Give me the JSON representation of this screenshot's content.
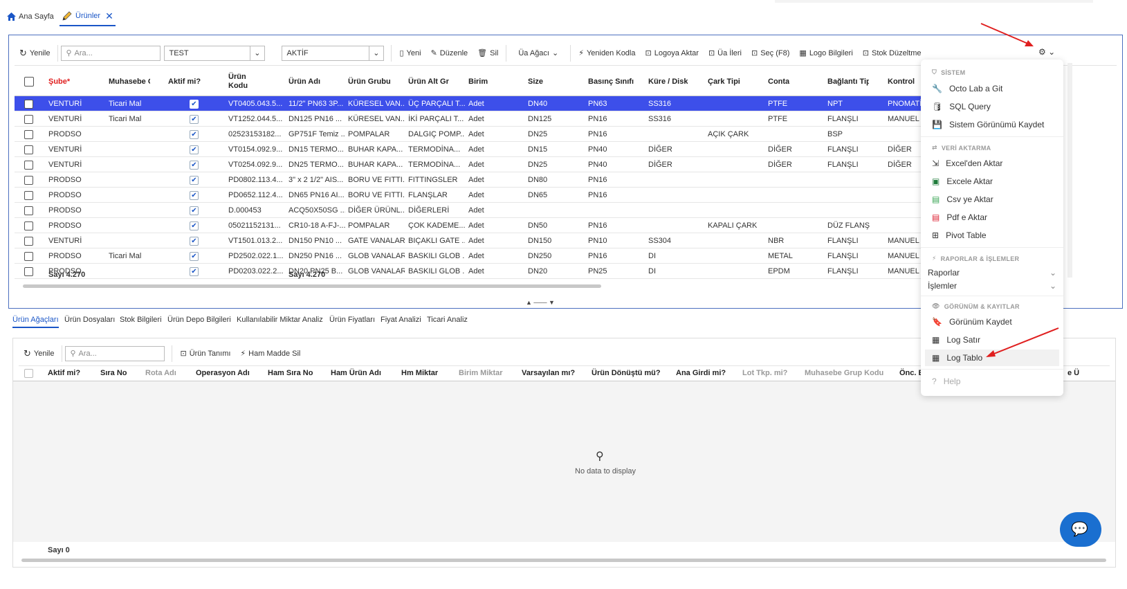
{
  "tabs": [
    {
      "label": "Ana Sayfa"
    },
    {
      "label": "Ürünler"
    }
  ],
  "toolbar": {
    "refresh": "Yenile",
    "search_placeholder": "Ara...",
    "filter1": "TEST",
    "filter2": "AKTİF",
    "new": "Yeni",
    "edit": "Düzenle",
    "delete": "Sil",
    "tree": "Üa Ağacı",
    "recode": "Yeniden Kodla",
    "logo_transfer": "Logoya Aktar",
    "ua_next": "Üa İleri",
    "select": "Seç (F8)",
    "logo_info": "Logo Bilgileri",
    "stock_fix": "Stok Düzeltme"
  },
  "table": {
    "columns": [
      "Şube",
      "Muhasebe G",
      "Aktif mi?",
      "Ürün Kodu",
      "Ürün Adı",
      "Ürün Grubu",
      "Ürün Alt Gr",
      "Birim",
      "Size",
      "Basınç Sınıfı",
      "Küre / Disk",
      "Çark Tipi",
      "Conta",
      "Bağlantı Tip",
      "Kontrol"
    ],
    "required_mark": "*",
    "rows": [
      [
        "VENTURİ",
        "Ticari Mal",
        "",
        "VT0405.043.5...",
        "11/2\" PN63 3P...",
        "KÜRESEL VAN...",
        "ÜÇ PARÇALI T...",
        "Adet",
        "DN40",
        "PN63",
        "SS316",
        "",
        "PTFE",
        "NPT",
        "PNOMATİ"
      ],
      [
        "VENTURİ",
        "Ticari Mal",
        "",
        "VT1252.044.5...",
        "DN125 PN16 ...",
        "KÜRESEL VAN...",
        "İKİ PARÇALI T...",
        "Adet",
        "DN125",
        "PN16",
        "SS316",
        "",
        "PTFE",
        "FLANŞLI",
        "MANUEL"
      ],
      [
        "PRODSO",
        "",
        "",
        "02523153182...",
        "GP751F Temiz ...",
        "POMPALAR",
        "DALGIÇ POMP...",
        "Adet",
        "DN25",
        "PN16",
        "",
        "AÇIK ÇARK",
        "",
        "BSP",
        ""
      ],
      [
        "VENTURİ",
        "",
        "",
        "VT0154.092.9...",
        "DN15 TERMO...",
        "BUHAR KAPA...",
        "TERMODİNA...",
        "Adet",
        "DN15",
        "PN40",
        "DİĞER",
        "",
        "DİĞER",
        "FLANŞLI",
        "DİĞER"
      ],
      [
        "VENTURİ",
        "",
        "",
        "VT0254.092.9...",
        "DN25 TERMO...",
        "BUHAR KAPA...",
        "TERMODİNA...",
        "Adet",
        "DN25",
        "PN40",
        "DİĞER",
        "",
        "DİĞER",
        "FLANŞLI",
        "DİĞER"
      ],
      [
        "PRODSO",
        "",
        "",
        "PD0802.113.4...",
        "3\" x 2 1/2\" AIS...",
        "BORU VE FITTI...",
        "FITTINGSLER",
        "Adet",
        "DN80",
        "PN16",
        "",
        "",
        "",
        "",
        ""
      ],
      [
        "PRODSO",
        "",
        "",
        "PD0652.112.4...",
        "DN65 PN16 AI...",
        "BORU VE FITTI...",
        "FLANŞLAR",
        "Adet",
        "DN65",
        "PN16",
        "",
        "",
        "",
        "",
        ""
      ],
      [
        "PRODSO",
        "",
        "",
        "D.000453",
        "ACQ50X50SG ...",
        "DİĞER ÜRÜNL...",
        "DİĞERLERİ",
        "Adet",
        "",
        "",
        "",
        "",
        "",
        "",
        ""
      ],
      [
        "PRODSO",
        "",
        "",
        "05021152131...",
        "CR10-18 A-FJ-...",
        "POMPALAR",
        "ÇOK KADEME...",
        "Adet",
        "DN50",
        "PN16",
        "",
        "KAPALI ÇARK",
        "",
        "DÜZ FLANŞ",
        ""
      ],
      [
        "VENTURİ",
        "",
        "",
        "VT1501.013.2...",
        "DN150 PN10 ...",
        "GATE VANALAR",
        "BIÇAKLI GATE ...",
        "Adet",
        "DN150",
        "PN10",
        "SS304",
        "",
        "NBR",
        "FLANŞLI",
        "MANUEL"
      ],
      [
        "PRODSO",
        "Ticari Mal",
        "",
        "PD2502.022.1...",
        "DN250 PN16 ...",
        "GLOB VANALAR",
        "BASKILI GLOB ...",
        "Adet",
        "DN250",
        "PN16",
        "DI",
        "",
        "METAL",
        "FLANŞLI",
        "MANUEL"
      ],
      [
        "PRODSO",
        "",
        "",
        "PD0203.022.2...",
        "DN20 PN25 B...",
        "GLOB VANALAR",
        "BASKILI GLOB ...",
        "Adet",
        "DN20",
        "PN25",
        "DI",
        "",
        "EPDM",
        "FLANŞLI",
        "MANUEL"
      ]
    ],
    "footer_count1": "Sayı 4.270",
    "footer_count2": "Sayı 4.270"
  },
  "bottom_tabs": [
    "Ürün Ağaçları",
    "Ürün Dosyaları",
    "Stok Bilgileri",
    "Ürün Depo Bilgileri",
    "Kullanılabilir Miktar Analiz",
    "Ürün Fiyatları",
    "Fiyat Analizi",
    "Ticari Analiz"
  ],
  "bottom_toolbar": {
    "refresh": "Yenile",
    "search_placeholder": "Ara...",
    "product_def": "Ürün Tanımı",
    "delete_raw": "Ham Madde Sil"
  },
  "bottom_table": {
    "columns": [
      "Aktif mi?",
      "Sıra No",
      "Rota Adı",
      "Operasyon Adı",
      "Ham Sıra No",
      "Ham Ürün Adı",
      "Hm Miktar",
      "Birim Miktar",
      "Varsayılan mı?",
      "Ürün Dönüştü mü?",
      "Ana Girdi mi?",
      "Lot Tkp. mi?",
      "Muhasebe Grup Kodu",
      "Önc. B",
      "e Ü"
    ],
    "empty_text": "No data to display",
    "footer_count": "Sayı 0"
  },
  "menu": {
    "section1": "SİSTEM",
    "items1": [
      "Octo Lab a Git",
      "SQL Query",
      "Sistem Görünümü Kaydet"
    ],
    "section2": "VERİ AKTARMA",
    "items2": [
      "Excel'den Aktar",
      "Excele Aktar",
      "Csv ye Aktar",
      "Pdf e Aktar",
      "Pivot Table"
    ],
    "section3": "RAPORLAR & İŞLEMLER",
    "items3": [
      "Raporlar",
      "İşlemler"
    ],
    "section4": "GÖRÜNÜM & KAYITLAR",
    "items4": [
      "Görünüm Kaydet",
      "Log Satır",
      "Log Tablo"
    ],
    "help": "Help"
  },
  "colors": {
    "accent": "#1a56c7",
    "selected_row": "#3d4fea",
    "required": "#e02020",
    "arrow": "#e02020"
  }
}
